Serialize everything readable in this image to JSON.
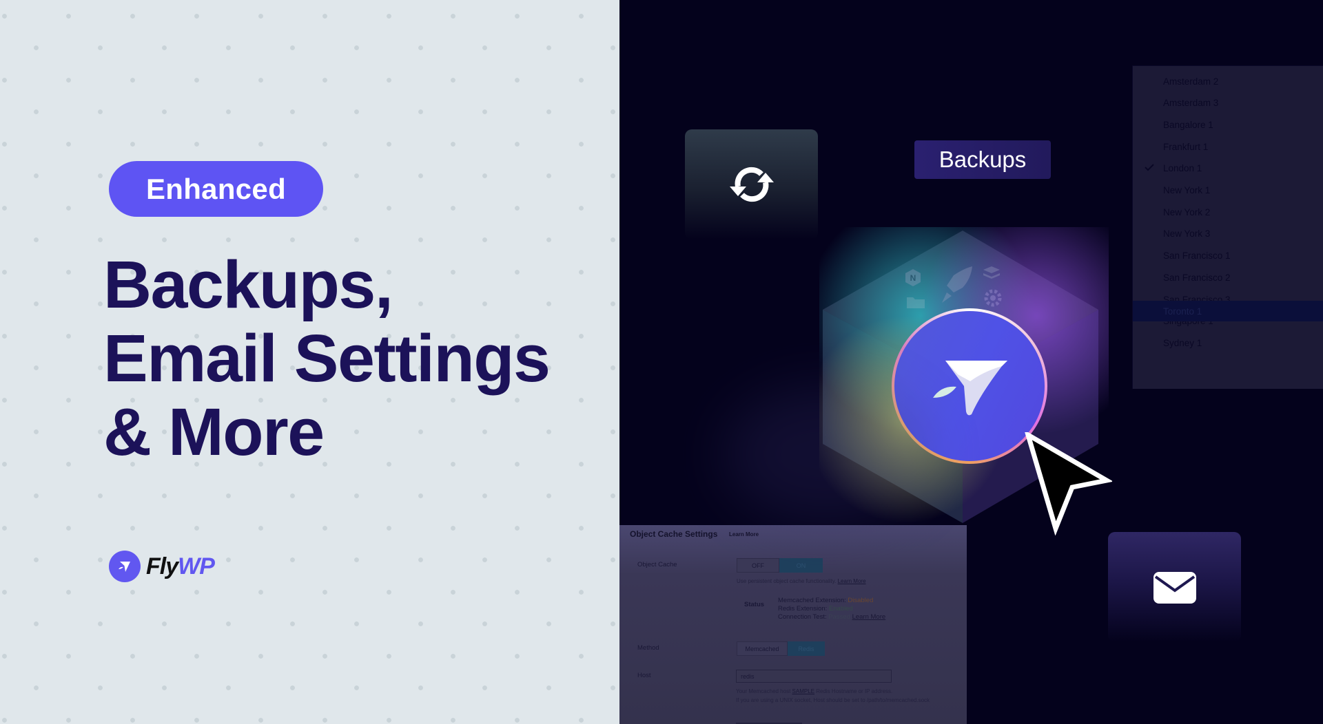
{
  "left": {
    "badge": "Enhanced",
    "headline": [
      "Backups,",
      "Email Settings",
      "& More"
    ],
    "logo": {
      "fly": "Fly",
      "wp": "WP",
      "icon": "paper-plane-icon"
    }
  },
  "right": {
    "sync_card": {
      "icon": "sync-icon"
    },
    "backups_chip": "Backups",
    "cube_icons": [
      "nginx-icon",
      "rocket-icon",
      "layers-icon",
      "folder-icon",
      "gear-icon"
    ],
    "center_logo": {
      "icon": "flywp-plane-icon"
    },
    "mail_card": {
      "icon": "envelope-icon"
    },
    "dropdown": {
      "items": [
        {
          "label": "Amsterdam 2",
          "selected": false
        },
        {
          "label": "Amsterdam 3",
          "selected": false
        },
        {
          "label": "Bangalore 1",
          "selected": false
        },
        {
          "label": "Frankfurt 1",
          "selected": false
        },
        {
          "label": "London 1",
          "selected": true
        },
        {
          "label": "New York 1",
          "selected": false
        },
        {
          "label": "New York 2",
          "selected": false
        },
        {
          "label": "New York 3",
          "selected": false
        },
        {
          "label": "San Francisco 1",
          "selected": false
        },
        {
          "label": "San Francisco 2",
          "selected": false
        },
        {
          "label": "San Francisco 3",
          "selected": false
        },
        {
          "label": "Singapore 1",
          "selected": false
        },
        {
          "label": "Sydney 1",
          "selected": false
        },
        {
          "label": "Toronto 1",
          "selected": false,
          "highlighted": true
        }
      ]
    },
    "settings": {
      "title": "Object Cache Settings",
      "learn_more": "Learn More",
      "object_cache": {
        "label": "Object Cache",
        "off": "OFF",
        "on": "ON",
        "value": "ON",
        "help": "Use persistent object cache functionality.",
        "help_link": "Learn More"
      },
      "status": {
        "label": "Status",
        "memcached_label": "Memcached Extension:",
        "memcached_value": "Disabled",
        "redis_label": "Redis Extension:",
        "redis_value": "Enabled",
        "connection_label": "Connection Test:",
        "connection_value": "Passed",
        "connection_link": "Learn More"
      },
      "method": {
        "label": "Method",
        "options": [
          "Memcached",
          "Redis"
        ],
        "value": "Redis"
      },
      "host": {
        "label": "Host",
        "value": "redis",
        "help1_pre": "Your Memcached host",
        "help1_link": "SAMPLE",
        "help1_post": "Redis Hostname or IP address.",
        "help2": "If you are using a UNIX socket, Host should be set to /path/to/memcached.sock"
      }
    },
    "colors": {
      "accent": "#5e54f3",
      "headline": "#1c1259",
      "dark_bg": "#04021c"
    }
  }
}
